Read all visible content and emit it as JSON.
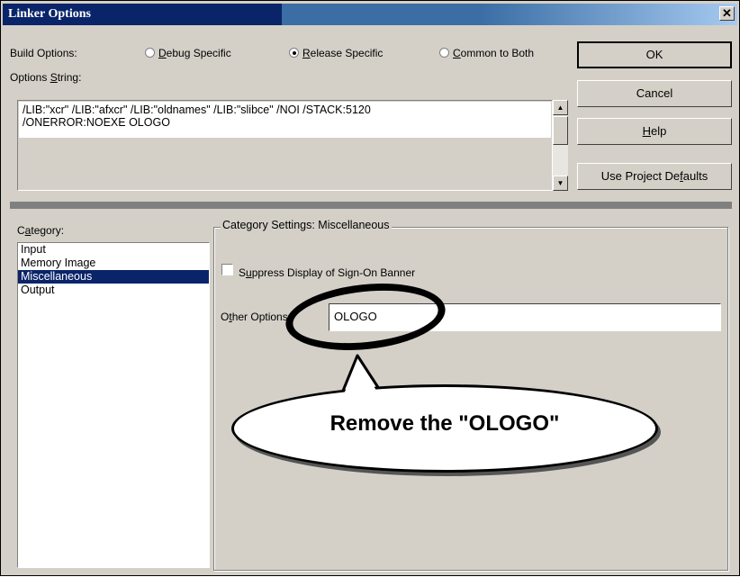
{
  "window": {
    "title": "Linker Options"
  },
  "build_options": {
    "label_pre": "Build Options:",
    "radios": [
      {
        "pre": "",
        "u": "D",
        "post": "ebug Specific",
        "selected": false
      },
      {
        "pre": "",
        "u": "R",
        "post": "elease Specific",
        "selected": true
      },
      {
        "pre": "",
        "u": "C",
        "post": "ommon to Both",
        "selected": false
      }
    ]
  },
  "options_string": {
    "label_pre": "Options ",
    "label_u": "S",
    "label_post": "tring:",
    "line1": "/LIB:\"xcr\" /LIB:\"afxcr\" /LIB:\"oldnames\" /LIB:\"slibce\" /NOI /STACK:5120",
    "line2": "/ONERROR:NOEXE OLOGO"
  },
  "buttons": {
    "ok": "OK",
    "cancel": "Cancel",
    "help_u": "H",
    "help_post": "elp",
    "defaults_pre": "Use Project De",
    "defaults_u": "f",
    "defaults_post": "aults"
  },
  "category": {
    "label_pre": "C",
    "label_u": "a",
    "label_post": "tegory:",
    "items": [
      "Input",
      "Memory Image",
      "Miscellaneous",
      "Output"
    ],
    "selected_index": 2
  },
  "settings": {
    "group_title": "Category Settings: Miscellaneous",
    "suppress_pre": "S",
    "suppress_u": "u",
    "suppress_post": "ppress Display of Sign-On Banner",
    "suppress_checked": false,
    "other_pre": "O",
    "other_u": "t",
    "other_post": "her Options:",
    "other_value": "OLOGO"
  },
  "annotation": {
    "callout_text": "Remove the \"OLOGO\""
  },
  "icons": {
    "close": "close-icon",
    "scroll_up": "scroll-up-arrow-icon",
    "scroll_down": "scroll-down-arrow-icon"
  }
}
